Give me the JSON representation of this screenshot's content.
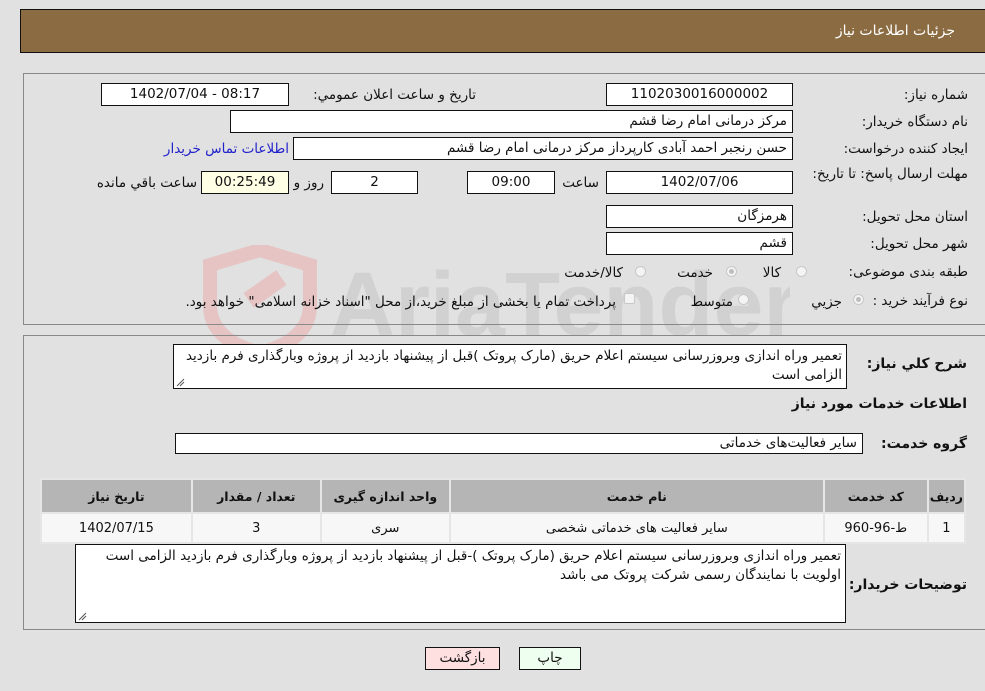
{
  "header": {
    "title": "جزئیات اطلاعات نیاز"
  },
  "details": {
    "need_number": {
      "label": "شماره نیاز:",
      "value": "1102030016000002"
    },
    "announce_datetime": {
      "label": "تاریخ و ساعت اعلان عمومي:",
      "value": "1402/07/04 - 08:17"
    },
    "buyer_org": {
      "label": "نام دستگاه خریدار:",
      "value": "مرکز درمانی امام رضا قشم"
    },
    "requester": {
      "label": "ایجاد کننده درخواست:",
      "value": "حسن رنجبر احمد آبادی کارپرداز مرکز درمانی امام رضا قشم"
    },
    "buyer_contact_link": "اطلاعات تماس خریدار",
    "deadline": {
      "label": "مهلت ارسال پاسخ: تا تاریخ:",
      "date": "1402/07/06",
      "time_label": "ساعت",
      "time": "09:00",
      "days": "2",
      "days_label": "روز و",
      "remaining": "00:25:49",
      "remaining_label": "ساعت باقي مانده"
    },
    "province": {
      "label": "استان محل تحویل:",
      "value": "هرمزگان"
    },
    "city": {
      "label": "شهر محل تحویل:",
      "value": "قشم"
    },
    "category": {
      "label": "طبقه بندی موضوعی:",
      "options": [
        "کالا",
        "خدمت",
        "کالا/خدمت"
      ],
      "selected": "خدمت"
    },
    "purchase_type": {
      "label": "نوع فرآیند خرید :",
      "options": [
        "جزيي",
        "متوسط"
      ],
      "selected": "جزيي",
      "treasury_note": "پرداخت تمام یا بخشی از مبلغ خرید،از محل \"اسناد خزانه اسلامی\" خواهد بود."
    }
  },
  "description": {
    "label": "شرح کلي نیاز:",
    "value": "تعمیر وراه اندازی وبروزرسانی سیستم اعلام حریق (مارک پروتک )قبل از پیشنهاد بازدید از پروژه وبارگذاری فرم بازدید الزامی است"
  },
  "services": {
    "section_title": "اطلاعات خدمات مورد نیاز",
    "group_label": "گروه خدمت:",
    "group_value": "سایر فعالیت‌های خدماتی",
    "table": {
      "columns": [
        "ردیف",
        "کد خدمت",
        "نام خدمت",
        "واحد اندازه گیری",
        "تعداد / مقدار",
        "تاریخ نیاز"
      ],
      "rows": [
        [
          "1",
          "ط-96-960",
          "سایر فعالیت های خدماتی شخصی",
          "سری",
          "3",
          "1402/07/15"
        ]
      ]
    }
  },
  "buyer_notes": {
    "label": "توضیحات خریدار:",
    "value": "تعمیر وراه اندازی وبروزرسانی سیستم اعلام حریق (مارک پروتک )-قبل از پیشنهاد بازدید از پروژه وبارگذاری فرم بازدید الزامی است اولویت با نمایندگان رسمی شرکت پروتک می باشد"
  },
  "buttons": {
    "print": "چاپ",
    "back": "بازگشت"
  },
  "watermark": "AriaTender.neT",
  "colors": {
    "header_bg": "#8b6b42",
    "print_bg": "#efffef",
    "back_bg": "#ffe0e0",
    "link": "#2222cc"
  }
}
